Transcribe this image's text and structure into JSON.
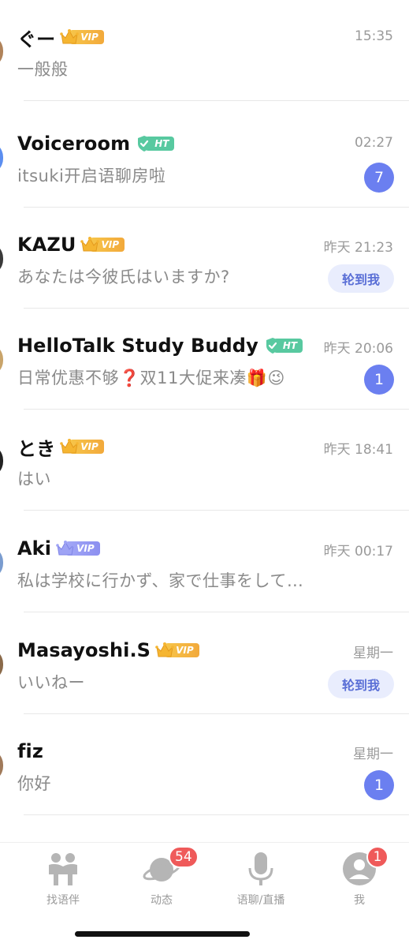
{
  "conversations": [
    {
      "name": "ぐー",
      "badge": "vip",
      "badge_color": "gold",
      "badge_text": "VIP",
      "time": "15:35",
      "preview": "一般般",
      "avatar_color": "#b0835a"
    },
    {
      "name": "Voiceroom",
      "badge": "ht",
      "badge_text": "HT",
      "time": "02:27",
      "preview": "itsuki开启语聊房啦",
      "unread": "7",
      "avatar_color": "#5b8ef0"
    },
    {
      "name": "KAZU",
      "badge": "vip",
      "badge_color": "gold",
      "badge_text": "VIP",
      "time": "昨天 21:23",
      "preview": "あなたは今彼氏はいますか?",
      "pill": "轮到我",
      "avatar_color": "#3a3a3a"
    },
    {
      "name": "HelloTalk Study Buddy",
      "badge": "ht",
      "badge_text": "HT",
      "time": "昨天 20:06",
      "preview": "日常优惠不够❓双11大促来凑🎁😉",
      "unread": "1",
      "avatar_color": "#c9a46a"
    },
    {
      "name": "とき",
      "badge": "vip",
      "badge_color": "gold",
      "badge_text": "VIP",
      "time": "昨天 18:41",
      "preview": "はい",
      "avatar_color": "#222222"
    },
    {
      "name": "Aki",
      "badge": "vip",
      "badge_color": "purple",
      "badge_text": "VIP",
      "time": "昨天 00:17",
      "preview": "私は学校に行かず、家で仕事をして…",
      "avatar_color": "#7a9ccf"
    },
    {
      "name": "Masayoshi.S",
      "badge": "vip",
      "badge_color": "gold",
      "badge_text": "VIP",
      "time": "星期一",
      "preview": "いいねー",
      "pill": "轮到我",
      "avatar_color": "#8a6a4a"
    },
    {
      "name": "fiz",
      "badge": "",
      "time": "星期一",
      "preview": "你好",
      "unread": "1",
      "avatar_color": "#a07a5a"
    }
  ],
  "tabbar": {
    "tabs": [
      {
        "label": "找语伴",
        "icon": "partners-icon"
      },
      {
        "label": "动态",
        "icon": "planet-icon",
        "badge": "54"
      },
      {
        "label": "语聊/直播",
        "icon": "microphone-icon"
      },
      {
        "label": "我",
        "icon": "profile-icon",
        "badge": "1"
      }
    ]
  },
  "colors": {
    "unread_badge": "#6b7ff0",
    "tab_badge": "#ef5a5a",
    "vip_gold": "#f2a93b",
    "vip_purple": "#8c8ff0",
    "ht_green": "#58c9a0"
  }
}
